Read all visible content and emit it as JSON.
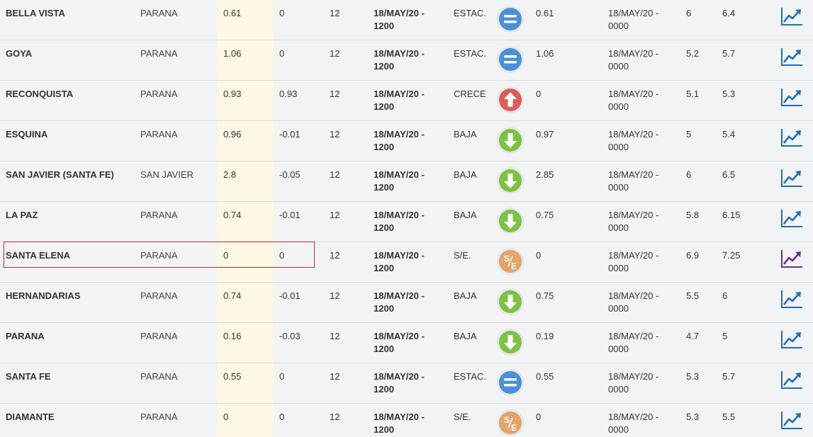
{
  "colors": {
    "estac": "#4a90d9",
    "crece": "#e05b55",
    "baja": "#7dc242",
    "se": "#e3a36a",
    "chart": "#1f6fb5",
    "chart_selected": "#6a2c91",
    "selection": "#c62828"
  },
  "rows": [
    {
      "station": "BELLA VISTA",
      "river": "PARANA",
      "level": "0.61",
      "variation": "0",
      "period": "12",
      "date": "18/MAY/20 - 1200",
      "trend": "ESTAC.",
      "icon": "equals-icon",
      "prev": "0.61",
      "prev_date": "18/MAY/20 - 0000",
      "alert": "6",
      "evac": "6.4"
    },
    {
      "station": "GOYA",
      "river": "PARANA",
      "level": "1.06",
      "variation": "0",
      "period": "12",
      "date": "18/MAY/20 - 1200",
      "trend": "ESTAC.",
      "icon": "equals-icon",
      "prev": "1.06",
      "prev_date": "18/MAY/20 - 0000",
      "alert": "5.2",
      "evac": "5.7"
    },
    {
      "station": "RECONQUISTA",
      "river": "PARANA",
      "level": "0.93",
      "variation": "0.93",
      "period": "12",
      "date": "18/MAY/20 - 1200",
      "trend": "CRECE",
      "icon": "arrow-up-icon",
      "prev": "0",
      "prev_date": "18/MAY/20 - 0000",
      "alert": "5.1",
      "evac": "5.3"
    },
    {
      "station": "ESQUINA",
      "river": "PARANA",
      "level": "0.96",
      "variation": "-0.01",
      "period": "12",
      "date": "18/MAY/20 - 1200",
      "trend": "BAJA",
      "icon": "arrow-down-icon",
      "prev": "0.97",
      "prev_date": "18/MAY/20 - 0000",
      "alert": "5",
      "evac": "5.4"
    },
    {
      "station": "SAN JAVIER (SANTA FE)",
      "river": "SAN JAVIER",
      "level": "2.8",
      "variation": "-0.05",
      "period": "12",
      "date": "18/MAY/20 - 1200",
      "trend": "BAJA",
      "icon": "arrow-down-icon",
      "prev": "2.85",
      "prev_date": "18/MAY/20 - 0000",
      "alert": "6",
      "evac": "6.5"
    },
    {
      "station": "LA PAZ",
      "river": "PARANA",
      "level": "0.74",
      "variation": "-0.01",
      "period": "12",
      "date": "18/MAY/20 - 1200",
      "trend": "BAJA",
      "icon": "arrow-down-icon",
      "prev": "0.75",
      "prev_date": "18/MAY/20 - 0000",
      "alert": "5.8",
      "evac": "6.15"
    },
    {
      "station": "SANTA ELENA",
      "river": "PARANA",
      "level": "0",
      "variation": "0",
      "period": "12",
      "date": "18/MAY/20 - 1200",
      "trend": "S/E.",
      "icon": "se-icon",
      "prev": "0",
      "prev_date": "18/MAY/20 - 0000",
      "alert": "6.9",
      "evac": "7.25",
      "selected": true
    },
    {
      "station": "HERNANDARIAS",
      "river": "PARANA",
      "level": "0.74",
      "variation": "-0.01",
      "period": "12",
      "date": "18/MAY/20 - 1200",
      "trend": "BAJA",
      "icon": "arrow-down-icon",
      "prev": "0.75",
      "prev_date": "18/MAY/20 - 0000",
      "alert": "5.5",
      "evac": "6"
    },
    {
      "station": "PARANA",
      "river": "PARANA",
      "level": "0.16",
      "variation": "-0.03",
      "period": "12",
      "date": "18/MAY/20 - 1200",
      "trend": "BAJA",
      "icon": "arrow-down-icon",
      "prev": "0.19",
      "prev_date": "18/MAY/20 - 0000",
      "alert": "4.7",
      "evac": "5"
    },
    {
      "station": "SANTA FE",
      "river": "PARANA",
      "level": "0.55",
      "variation": "0",
      "period": "12",
      "date": "18/MAY/20 - 1200",
      "trend": "ESTAC.",
      "icon": "equals-icon",
      "prev": "0.55",
      "prev_date": "18/MAY/20 - 0000",
      "alert": "5.3",
      "evac": "5.7"
    },
    {
      "station": "DIAMANTE",
      "river": "PARANA",
      "level": "0",
      "variation": "0",
      "period": "12",
      "date": "18/MAY/20 - 1200",
      "trend": "S/E.",
      "icon": "se-icon",
      "prev": "0",
      "prev_date": "18/MAY/20 - 0000",
      "alert": "5.3",
      "evac": "5.5"
    }
  ]
}
